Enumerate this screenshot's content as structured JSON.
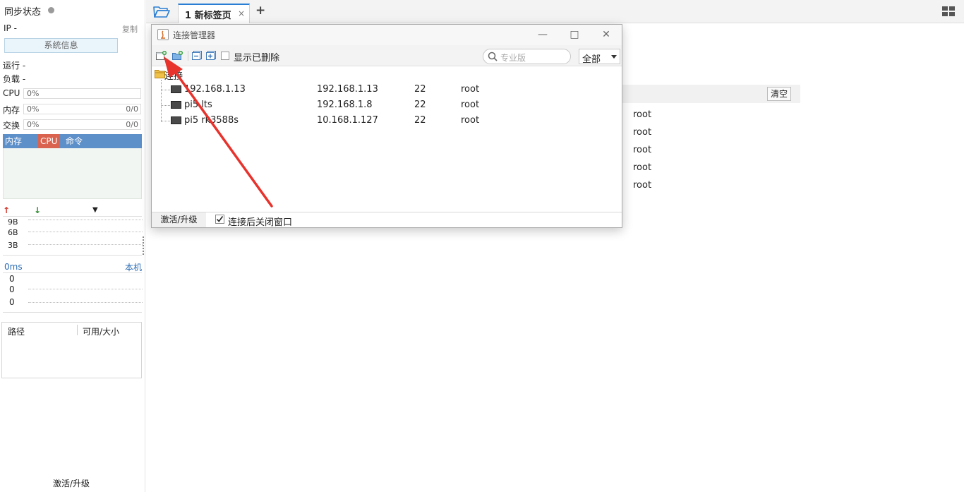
{
  "sidebar": {
    "sync_title": "同步状态",
    "ip_label": "IP  -",
    "copy_label": "复制",
    "sysinfo_button": "系统信息",
    "run_label": "运行 -",
    "load_label": "负载 -",
    "meters": [
      {
        "label": "CPU",
        "value": "0%",
        "extra": ""
      },
      {
        "label": "内存",
        "value": "0%",
        "extra": "0/0"
      },
      {
        "label": "交换",
        "value": "0%",
        "extra": "0/0"
      }
    ],
    "proc_tabs": [
      "内存",
      "CPU",
      "命令"
    ],
    "net_ticks": [
      "9B",
      "6B",
      "3B"
    ],
    "ping_ms": "0ms",
    "ping_host": "本机",
    "ping_ticks": [
      "0",
      "0",
      "0"
    ],
    "disk_headers": [
      "路径",
      "可用/大小"
    ],
    "activate_label": "激活/升级"
  },
  "tabs": {
    "active_tab": "1 新标签页",
    "close_glyph": "×",
    "add_glyph": "+"
  },
  "background": {
    "clear_button": "清空",
    "users": [
      "root",
      "root",
      "root",
      "root",
      "root"
    ]
  },
  "dialog": {
    "title": "连接管理器",
    "toolbar": {
      "show_deleted_label": "显示已删除",
      "search_placeholder": "专业版",
      "filter_value": "全部"
    },
    "tree_root": "连接",
    "connections": [
      {
        "name": "192.168.1.13",
        "host": "192.168.1.13",
        "port": "22",
        "user": "root"
      },
      {
        "name": "pi5 lts",
        "host": "192.168.1.8",
        "port": "22",
        "user": "root"
      },
      {
        "name": "pi5 rk3588s",
        "host": "10.168.1.127",
        "port": "22",
        "user": "root"
      }
    ],
    "status": {
      "activate_label": "激活/升级",
      "close_after_connect_label": "连接后关闭窗口",
      "close_after_connect_checked": true
    }
  },
  "colors": {
    "accent_blue": "#2a7fd4",
    "cpu_tab": "#d9634f",
    "proc_tabs_bg": "#5d8fc9",
    "annotation_arrow": "#e8322c"
  }
}
